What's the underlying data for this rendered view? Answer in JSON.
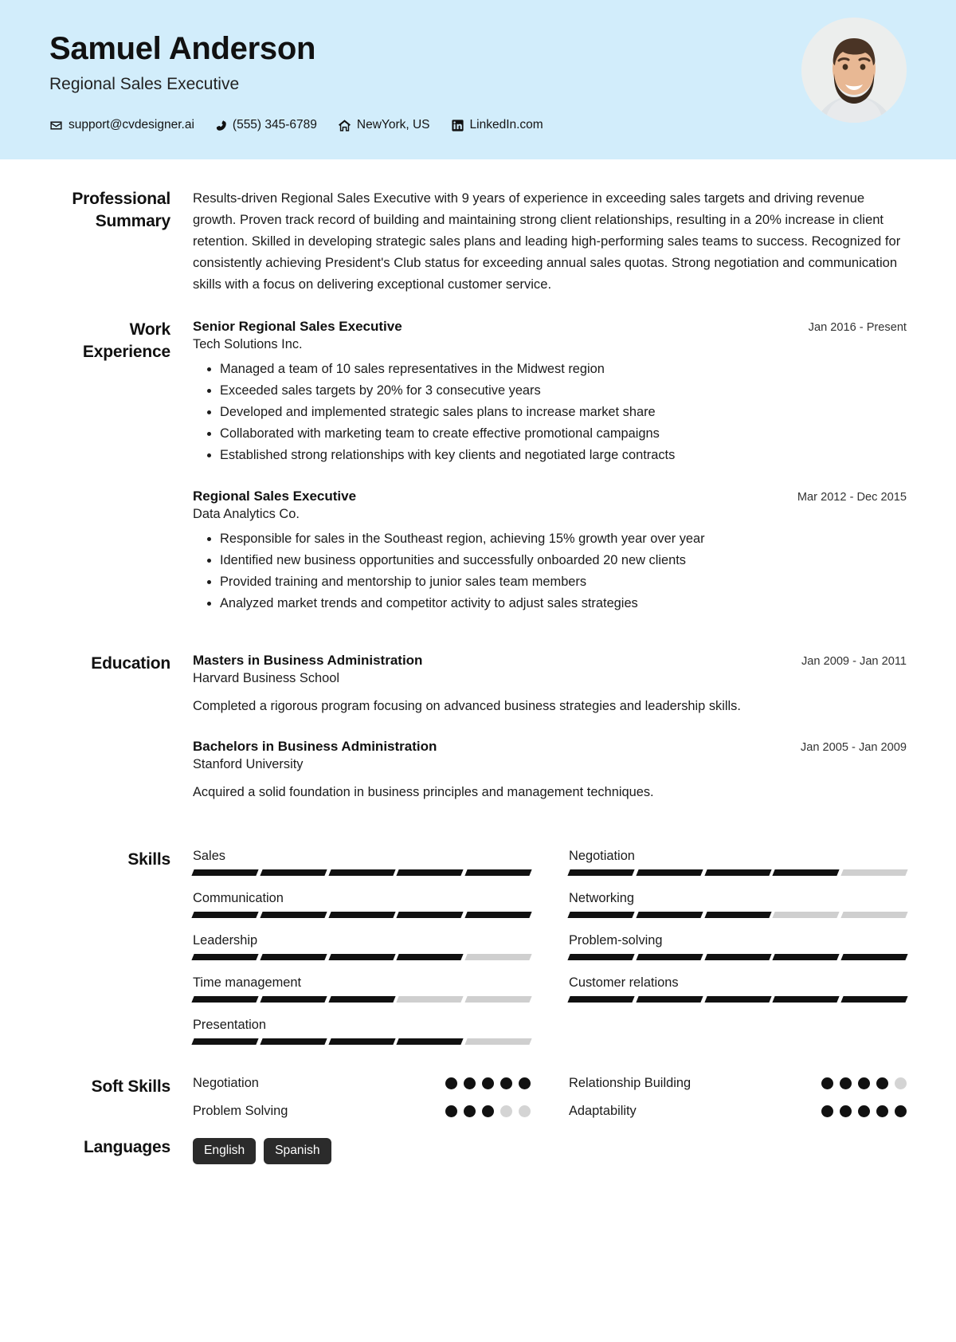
{
  "header": {
    "name": "Samuel Anderson",
    "job_title": "Regional Sales Executive",
    "contacts": [
      {
        "icon": "envelope-icon",
        "text": "support@cvdesigner.ai"
      },
      {
        "icon": "phone-icon",
        "text": "(555) 345-6789"
      },
      {
        "icon": "home-icon",
        "text": "NewYork, US"
      },
      {
        "icon": "linkedin-icon",
        "text": "LinkedIn.com"
      }
    ],
    "background_color": "#d2edfb",
    "avatar_alt": "profile-photo"
  },
  "sections": {
    "summary": {
      "label_line1": "Professional",
      "label_line2": "Summary",
      "text": "Results-driven Regional Sales Executive with 9 years of experience in exceeding sales targets and driving revenue growth. Proven track record of building and maintaining strong client relationships, resulting in a 20% increase in client retention. Skilled in developing strategic sales plans and leading high-performing sales teams to success. Recognized for consistently achieving President's Club status for exceeding annual sales quotas. Strong negotiation and communication skills with a focus on delivering exceptional customer service."
    },
    "work": {
      "label_line1": "Work",
      "label_line2": "Experience",
      "entries": [
        {
          "title": "Senior Regional Sales Executive",
          "org": "Tech Solutions Inc.",
          "date": "Jan 2016 - Present",
          "bullets": [
            "Managed a team of 10 sales representatives in the Midwest region",
            "Exceeded sales targets by 20% for 3 consecutive years",
            "Developed and implemented strategic sales plans to increase market share",
            "Collaborated with marketing team to create effective promotional campaigns",
            "Established strong relationships with key clients and negotiated large contracts"
          ]
        },
        {
          "title": "Regional Sales Executive",
          "org": "Data Analytics Co.",
          "date": "Mar 2012 - Dec 2015",
          "bullets": [
            "Responsible for sales in the Southeast region, achieving 15% growth year over year",
            "Identified new business opportunities and successfully onboarded 20 new clients",
            "Provided training and mentorship to junior sales team members",
            "Analyzed market trends and competitor activity to adjust sales strategies"
          ]
        }
      ]
    },
    "education": {
      "label": "Education",
      "entries": [
        {
          "title": "Masters in Business Administration",
          "org": "Harvard Business School",
          "date": "Jan 2009 - Jan 2011",
          "description": "Completed a rigorous program focusing on advanced business strategies and leadership skills."
        },
        {
          "title": "Bachelors in Business Administration",
          "org": "Stanford University",
          "date": "Jan 2005 - Jan 2009",
          "description": "Acquired a solid foundation in business principles and management techniques."
        }
      ]
    },
    "skills": {
      "label": "Skills",
      "max_level": 5,
      "items": [
        {
          "name": "Sales",
          "level": 5,
          "column": "left"
        },
        {
          "name": "Communication",
          "level": 5,
          "column": "left"
        },
        {
          "name": "Leadership",
          "level": 4,
          "column": "left"
        },
        {
          "name": "Time management",
          "level": 3,
          "column": "left"
        },
        {
          "name": "Presentation",
          "level": 4,
          "column": "left"
        },
        {
          "name": "Negotiation",
          "level": 4,
          "column": "right"
        },
        {
          "name": "Networking",
          "level": 3,
          "column": "right"
        },
        {
          "name": "Problem-solving",
          "level": 5,
          "column": "right"
        },
        {
          "name": "Customer relations",
          "level": 5,
          "column": "right"
        }
      ]
    },
    "soft_skills": {
      "label": "Soft Skills",
      "max_level": 5,
      "items": [
        {
          "name": "Negotiation",
          "level": 5
        },
        {
          "name": "Relationship Building",
          "level": 4
        },
        {
          "name": "Problem Solving",
          "level": 3
        },
        {
          "name": "Adaptability",
          "level": 5
        }
      ]
    },
    "languages": {
      "label": "Languages",
      "items": [
        "English",
        "Spanish"
      ]
    }
  }
}
